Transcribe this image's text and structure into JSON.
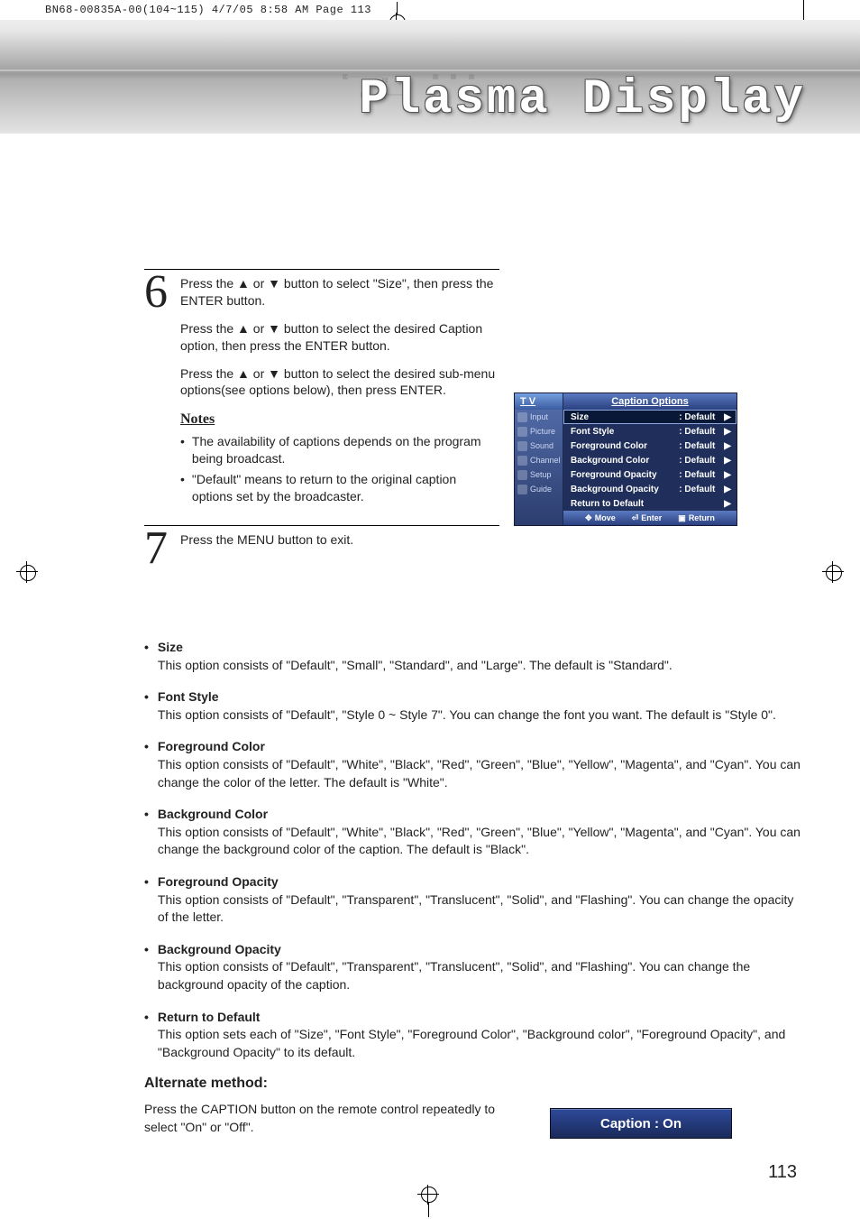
{
  "print_header": "BN68-00835A-00(104~115)  4/7/05  8:58 AM  Page 113",
  "banner_title": "Plasma Display",
  "steps": {
    "s6": {
      "num": "6",
      "p1a": "Press the ",
      "p1b": " or ",
      "p1c": " button to select \"Size\", then press the ENTER button.",
      "p2a": "Press the ",
      "p2b": " or ",
      "p2c": " button to select the desired Caption option, then press the ENTER button.",
      "p3a": "Press the ",
      "p3b": " or ",
      "p3c": " button to select the desired sub-menu options(see options below), then press ENTER."
    },
    "notes_title": "Notes",
    "notes": [
      "The availability of captions depends on the program being broadcast.",
      "\"Default\" means to return to the original caption options set by the broadcaster."
    ],
    "s7": {
      "num": "7",
      "p1": "Press the MENU button to exit."
    }
  },
  "osd": {
    "tv": "T V",
    "title": "Caption Options",
    "side": [
      "Input",
      "Picture",
      "Sound",
      "Channel",
      "Setup",
      "Guide"
    ],
    "rows": [
      {
        "label": "Size",
        "val": ": Default"
      },
      {
        "label": "Font Style",
        "val": ": Default"
      },
      {
        "label": "Foreground Color",
        "val": ": Default"
      },
      {
        "label": "Background Color",
        "val": ": Default"
      },
      {
        "label": "Foreground Opacity",
        "val": ": Default"
      },
      {
        "label": "Background Opacity",
        "val": ": Default"
      },
      {
        "label": "Return to Default",
        "val": ""
      }
    ],
    "foot": {
      "move": "Move",
      "enter": "Enter",
      "return": "Return"
    }
  },
  "descriptions": [
    {
      "t": "Size",
      "d": "This option consists of \"Default\", \"Small\", \"Standard\", and \"Large\". The default is \"Standard\"."
    },
    {
      "t": "Font Style",
      "d": "This option consists of \"Default\", \"Style 0 ~ Style 7\". You can change the font you want. The default is \"Style 0\"."
    },
    {
      "t": "Foreground Color",
      "d": "This option consists of \"Default\", \"White\", \"Black\", \"Red\", \"Green\", \"Blue\", \"Yellow\", \"Magenta\", and \"Cyan\". You can change the color of the letter. The default is \"White\"."
    },
    {
      "t": "Background Color",
      "d": "This option consists of \"Default\", \"White\", \"Black\", \"Red\", \"Green\", \"Blue\", \"Yellow\", \"Magenta\", and \"Cyan\". You can change the background color of the caption. The default is \"Black\"."
    },
    {
      "t": "Foreground Opacity",
      "d": "This option consists of \"Default\", \"Transparent\", \"Translucent\", \"Solid\", and \"Flashing\". You can change the opacity of the letter."
    },
    {
      "t": "Background Opacity",
      "d": "This option consists of \"Default\", \"Transparent\", \"Translucent\", \"Solid\", and \"Flashing\". You can change the background opacity of the caption."
    },
    {
      "t": "Return to Default",
      "d": "This option sets each of \"Size\", \"Font Style\", \"Foreground Color\", \"Background color\", \"Foreground Opacity\", and \"Background Opacity\" to its default."
    }
  ],
  "alt": {
    "heading": "Alternate method:",
    "text": "Press the CAPTION button on the remote control repeatedly to select \"On\" or \"Off\".",
    "box": "Caption : On"
  },
  "page_number": "113"
}
